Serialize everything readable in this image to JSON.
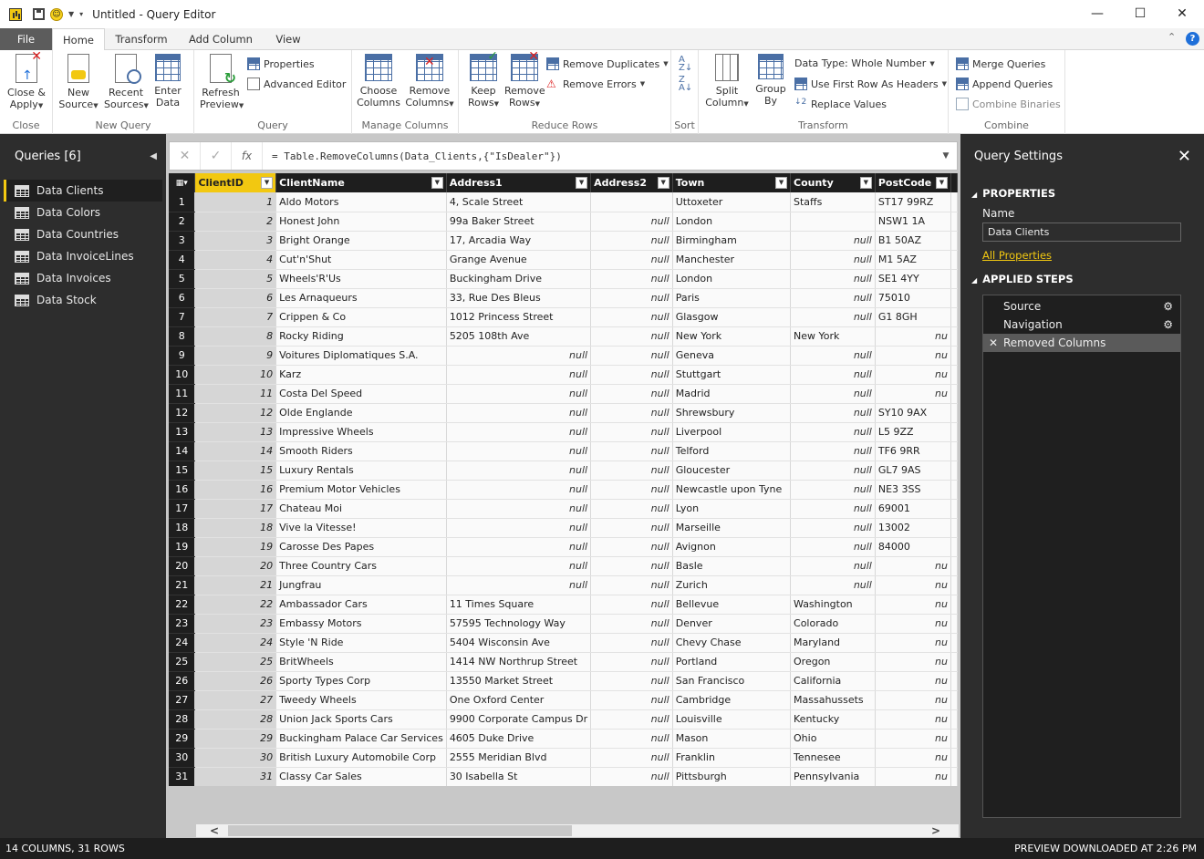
{
  "window": {
    "title": "Untitled - Query Editor",
    "min_icon": "minimize-icon",
    "max_icon": "maximize-icon",
    "close_icon": "close-icon"
  },
  "tabs": [
    "File",
    "Home",
    "Transform",
    "Add Column",
    "View"
  ],
  "ribbon": {
    "close": {
      "label": "Close",
      "btn": "Close &\nApply"
    },
    "new_query": {
      "label": "New Query",
      "new_source": "New\nSource",
      "recent_sources": "Recent\nSources",
      "enter_data": "Enter\nData"
    },
    "query": {
      "label": "Query",
      "refresh": "Refresh\nPreview",
      "properties": "Properties",
      "advanced_editor": "Advanced Editor"
    },
    "manage_columns": {
      "label": "Manage Columns",
      "choose": "Choose\nColumns",
      "remove": "Remove\nColumns"
    },
    "reduce_rows": {
      "label": "Reduce Rows",
      "keep": "Keep\nRows",
      "remove": "Remove\nRows",
      "remove_duplicates": "Remove Duplicates",
      "remove_errors": "Remove Errors"
    },
    "sort": {
      "label": "Sort"
    },
    "transform": {
      "label": "Transform",
      "split": "Split\nColumn",
      "group": "Group\nBy",
      "data_type": "Data Type: Whole Number",
      "first_row": "Use First Row As Headers",
      "replace": "Replace Values"
    },
    "combine": {
      "label": "Combine",
      "merge": "Merge Queries",
      "append": "Append Queries",
      "binaries": "Combine Binaries"
    }
  },
  "queries": {
    "header": "Queries [6]",
    "items": [
      "Data Clients",
      "Data Colors",
      "Data Countries",
      "Data InvoiceLines",
      "Data Invoices",
      "Data Stock"
    ],
    "active": 0
  },
  "formula": {
    "text": "= Table.RemoveColumns(Data_Clients,{\"IsDealer\"})",
    "fx": "fx"
  },
  "table": {
    "columns": [
      "ClientID",
      "ClientName",
      "Address1",
      "Address2",
      "Town",
      "County",
      "PostCode"
    ],
    "rows": [
      [
        "1",
        "Aldo Motors",
        "4, Scale Street",
        "",
        "Uttoxeter",
        "Staffs",
        "ST17 99RZ"
      ],
      [
        "2",
        "Honest John",
        "99a Baker Street",
        "null",
        "London",
        "",
        "NSW1 1A"
      ],
      [
        "3",
        "Bright Orange",
        "17, Arcadia Way",
        "null",
        "Birmingham",
        "null",
        "B1 50AZ"
      ],
      [
        "4",
        "Cut'n'Shut",
        "Grange Avenue",
        "null",
        "Manchester",
        "null",
        "M1 5AZ"
      ],
      [
        "5",
        "Wheels'R'Us",
        "Buckingham Drive",
        "null",
        "London",
        "null",
        "SE1 4YY"
      ],
      [
        "6",
        "Les Arnaqueurs",
        "33, Rue Des Bleus",
        "null",
        "Paris",
        "null",
        "75010"
      ],
      [
        "7",
        "Crippen & Co",
        "1012 Princess Street",
        "null",
        "Glasgow",
        "null",
        "G1 8GH"
      ],
      [
        "8",
        "Rocky Riding",
        "5205 108th Ave",
        "null",
        "New York",
        "New York",
        "nu"
      ],
      [
        "9",
        "Voitures Diplomatiques S.A.",
        "null",
        "null",
        "Geneva",
        "null",
        "nu"
      ],
      [
        "10",
        "Karz",
        "null",
        "null",
        "Stuttgart",
        "null",
        "nu"
      ],
      [
        "11",
        "Costa Del Speed",
        "null",
        "null",
        "Madrid",
        "null",
        "nu"
      ],
      [
        "12",
        "Olde Englande",
        "null",
        "null",
        "Shrewsbury",
        "null",
        "SY10 9AX"
      ],
      [
        "13",
        "Impressive Wheels",
        "null",
        "null",
        "Liverpool",
        "null",
        "L5 9ZZ"
      ],
      [
        "14",
        "Smooth Riders",
        "null",
        "null",
        "Telford",
        "null",
        "TF6 9RR"
      ],
      [
        "15",
        "Luxury Rentals",
        "null",
        "null",
        "Gloucester",
        "null",
        "GL7 9AS"
      ],
      [
        "16",
        "Premium Motor Vehicles",
        "null",
        "null",
        "Newcastle upon Tyne",
        "null",
        "NE3 3SS"
      ],
      [
        "17",
        "Chateau Moi",
        "null",
        "null",
        "Lyon",
        "null",
        "69001"
      ],
      [
        "18",
        "Vive la Vitesse!",
        "null",
        "null",
        "Marseille",
        "null",
        "13002"
      ],
      [
        "19",
        "Carosse Des Papes",
        "null",
        "null",
        "Avignon",
        "null",
        "84000"
      ],
      [
        "20",
        "Three Country Cars",
        "null",
        "null",
        "Basle",
        "null",
        "nu"
      ],
      [
        "21",
        "Jungfrau",
        "null",
        "null",
        "Zurich",
        "null",
        "nu"
      ],
      [
        "22",
        "Ambassador Cars",
        "11 Times Square",
        "null",
        "Bellevue",
        "Washington",
        "nu"
      ],
      [
        "23",
        "Embassy Motors",
        "57595 Technology Way",
        "null",
        "Denver",
        "Colorado",
        "nu"
      ],
      [
        "24",
        "Style 'N Ride",
        "5404 Wisconsin Ave",
        "null",
        "Chevy Chase",
        "Maryland",
        "nu"
      ],
      [
        "25",
        "BritWheels",
        "1414 NW Northrup Street",
        "null",
        "Portland",
        "Oregon",
        "nu"
      ],
      [
        "26",
        "Sporty Types Corp",
        "13550 Market Street",
        "null",
        "San Francisco",
        "California",
        "nu"
      ],
      [
        "27",
        "Tweedy Wheels",
        "One Oxford Center",
        "null",
        "Cambridge",
        "Massahussets",
        "nu"
      ],
      [
        "28",
        "Union Jack Sports Cars",
        "9900 Corporate Campus Dr",
        "null",
        "Louisville",
        "Kentucky",
        "nu"
      ],
      [
        "29",
        "Buckingham Palace Car Services",
        "4605 Duke Drive",
        "null",
        "Mason",
        "Ohio",
        "nu"
      ],
      [
        "30",
        "British Luxury Automobile Corp",
        "2555 Meridian Blvd",
        "null",
        "Franklin",
        "Tennesee",
        "nu"
      ],
      [
        "31",
        "Classy Car Sales",
        "30 Isabella St",
        "null",
        "Pittsburgh",
        "Pennsylvania",
        "nu"
      ]
    ]
  },
  "settings": {
    "header": "Query Settings",
    "properties": "PROPERTIES",
    "name_label": "Name",
    "name_value": "Data Clients",
    "all_properties": "All Properties",
    "applied_steps": "APPLIED STEPS",
    "steps": [
      "Source",
      "Navigation",
      "Removed Columns"
    ]
  },
  "status": {
    "left": "14 COLUMNS, 31 ROWS",
    "right": "PREVIEW DOWNLOADED AT 2:26 PM"
  }
}
